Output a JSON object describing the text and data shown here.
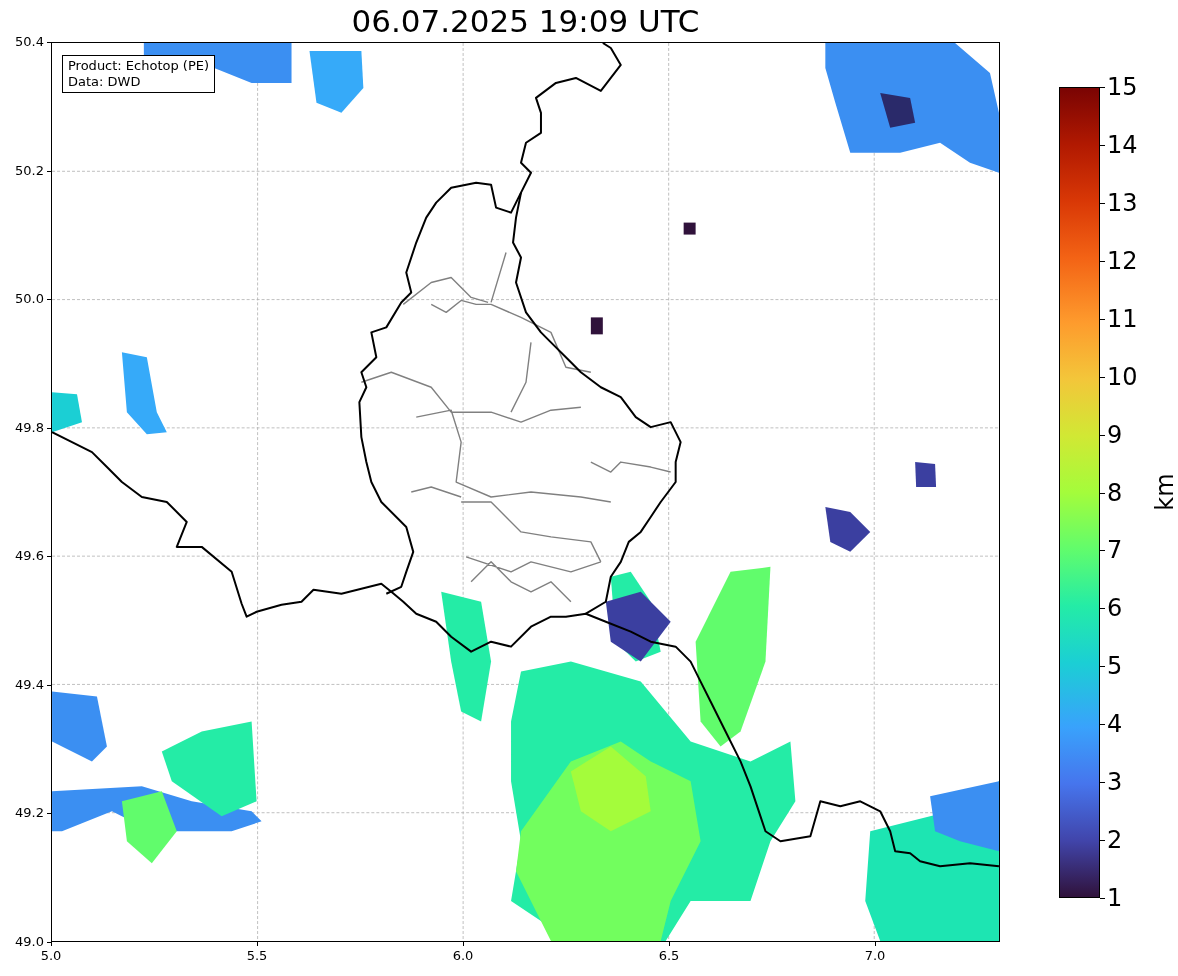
{
  "title": "06.07.2025 19:09 UTC",
  "info_box": {
    "lines": [
      "Product: Echotop (PE)",
      "Data: DWD"
    ]
  },
  "x_axis": {
    "ticks": [
      "5.0",
      "5.5",
      "6.0",
      "6.5",
      "7.0"
    ]
  },
  "y_axis": {
    "ticks": [
      "50.4",
      "50.2",
      "50.0",
      "49.8",
      "49.6",
      "49.4",
      "49.2",
      "49.0"
    ]
  },
  "colorbar": {
    "label": "km",
    "ticks": [
      "15",
      "14",
      "13",
      "12",
      "11",
      "10",
      "9",
      "8",
      "7",
      "6",
      "5",
      "4",
      "3",
      "2",
      "1"
    ]
  }
}
